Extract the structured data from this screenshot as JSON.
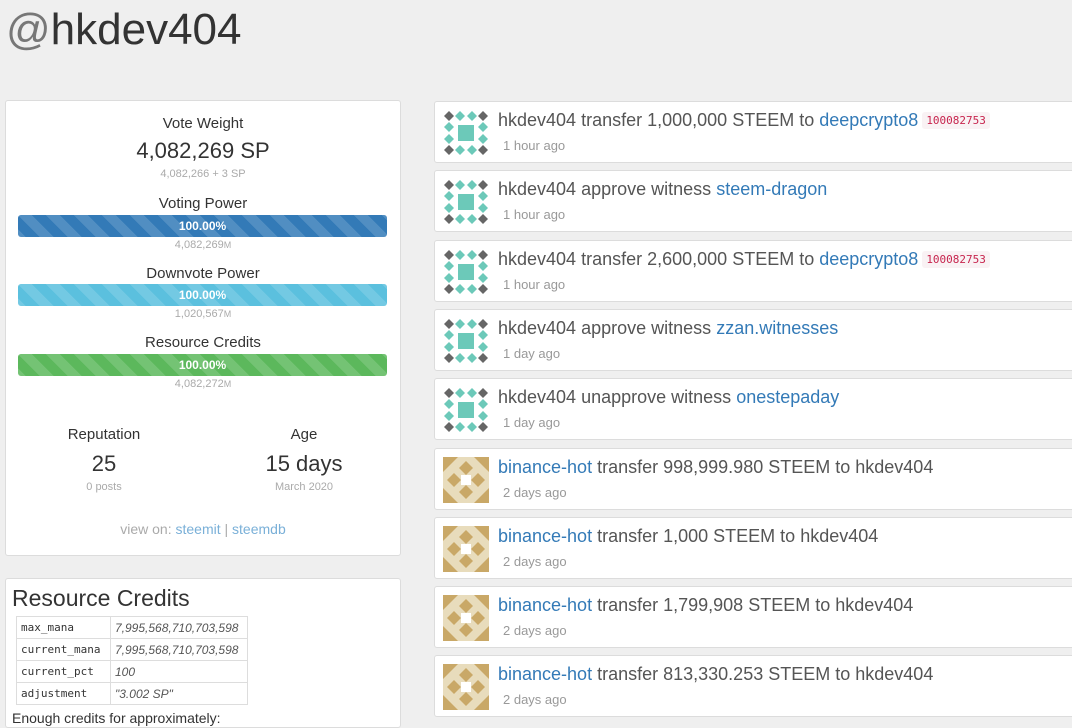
{
  "header": {
    "at": "@",
    "username": "hkdev404"
  },
  "profile": {
    "vote_weight": {
      "label": "Vote Weight",
      "value": "4,082,269 SP",
      "detail": "4,082,266 + 3 SP"
    },
    "voting_power": {
      "label": "Voting Power",
      "percent": 100,
      "percent_text": "100.00%",
      "amount": "4,082,269",
      "unit": "M"
    },
    "downvote_power": {
      "label": "Downvote Power",
      "percent": 100,
      "percent_text": "100.00%",
      "amount": "1,020,567",
      "unit": "M"
    },
    "resource_credits": {
      "label": "Resource Credits",
      "percent": 100,
      "percent_text": "100.00%",
      "amount": "4,082,272",
      "unit": "M"
    },
    "reputation": {
      "label": "Reputation",
      "value": "25",
      "sub": "0 posts"
    },
    "age": {
      "label": "Age",
      "value": "15 days",
      "sub": "March 2020"
    },
    "view_on": {
      "label": "view on:",
      "link1": "steemit",
      "sep": "|",
      "link2": "steemdb"
    }
  },
  "rc_panel": {
    "title": "Resource Credits",
    "rows": [
      {
        "key": "max_mana",
        "value": "7,995,568,710,703,598"
      },
      {
        "key": "current_mana",
        "value": "7,995,568,710,703,598"
      },
      {
        "key": "current_pct",
        "value": "100"
      },
      {
        "key": "adjustment",
        "value": "\"3.002 SP\""
      }
    ],
    "footer": "Enough credits for approximately:"
  },
  "colors": {
    "link": "#337ab7",
    "memo": "#c7254e",
    "bar_blue": "#337ab7",
    "bar_cyan": "#5bc0de",
    "bar_green": "#5cb85c"
  },
  "feed": [
    {
      "avatar": "teal-identicon",
      "actor": "hkdev404",
      "actor_link": false,
      "action": "transfer 1,000,000 STEEM to",
      "target": "deepcrypto8",
      "target_link": true,
      "memo": "100082753",
      "time": "1 hour ago"
    },
    {
      "avatar": "teal-identicon",
      "actor": "hkdev404",
      "actor_link": false,
      "action": "approve witness",
      "target": "steem-dragon",
      "target_link": true,
      "memo": "",
      "time": "1 hour ago"
    },
    {
      "avatar": "teal-identicon",
      "actor": "hkdev404",
      "actor_link": false,
      "action": "transfer 2,600,000 STEEM to",
      "target": "deepcrypto8",
      "target_link": true,
      "memo": "100082753",
      "time": "1 hour ago"
    },
    {
      "avatar": "teal-identicon",
      "actor": "hkdev404",
      "actor_link": false,
      "action": "approve witness",
      "target": "zzan.witnesses",
      "target_link": true,
      "memo": "",
      "time": "1 day ago"
    },
    {
      "avatar": "teal-identicon",
      "actor": "hkdev404",
      "actor_link": false,
      "action": "unapprove witness",
      "target": "onestepaday",
      "target_link": true,
      "memo": "",
      "time": "1 day ago"
    },
    {
      "avatar": "gold-identicon",
      "actor": "binance-hot",
      "actor_link": true,
      "action": "transfer 998,999.980 STEEM to",
      "target": "hkdev404",
      "target_link": false,
      "memo": "",
      "time": "2 days ago"
    },
    {
      "avatar": "gold-identicon",
      "actor": "binance-hot",
      "actor_link": true,
      "action": "transfer 1,000 STEEM to",
      "target": "hkdev404",
      "target_link": false,
      "memo": "",
      "time": "2 days ago"
    },
    {
      "avatar": "gold-identicon",
      "actor": "binance-hot",
      "actor_link": true,
      "action": "transfer 1,799,908 STEEM to",
      "target": "hkdev404",
      "target_link": false,
      "memo": "",
      "time": "2 days ago"
    },
    {
      "avatar": "gold-identicon",
      "actor": "binance-hot",
      "actor_link": true,
      "action": "transfer 813,330.253 STEEM to",
      "target": "hkdev404",
      "target_link": false,
      "memo": "",
      "time": "2 days ago"
    }
  ]
}
